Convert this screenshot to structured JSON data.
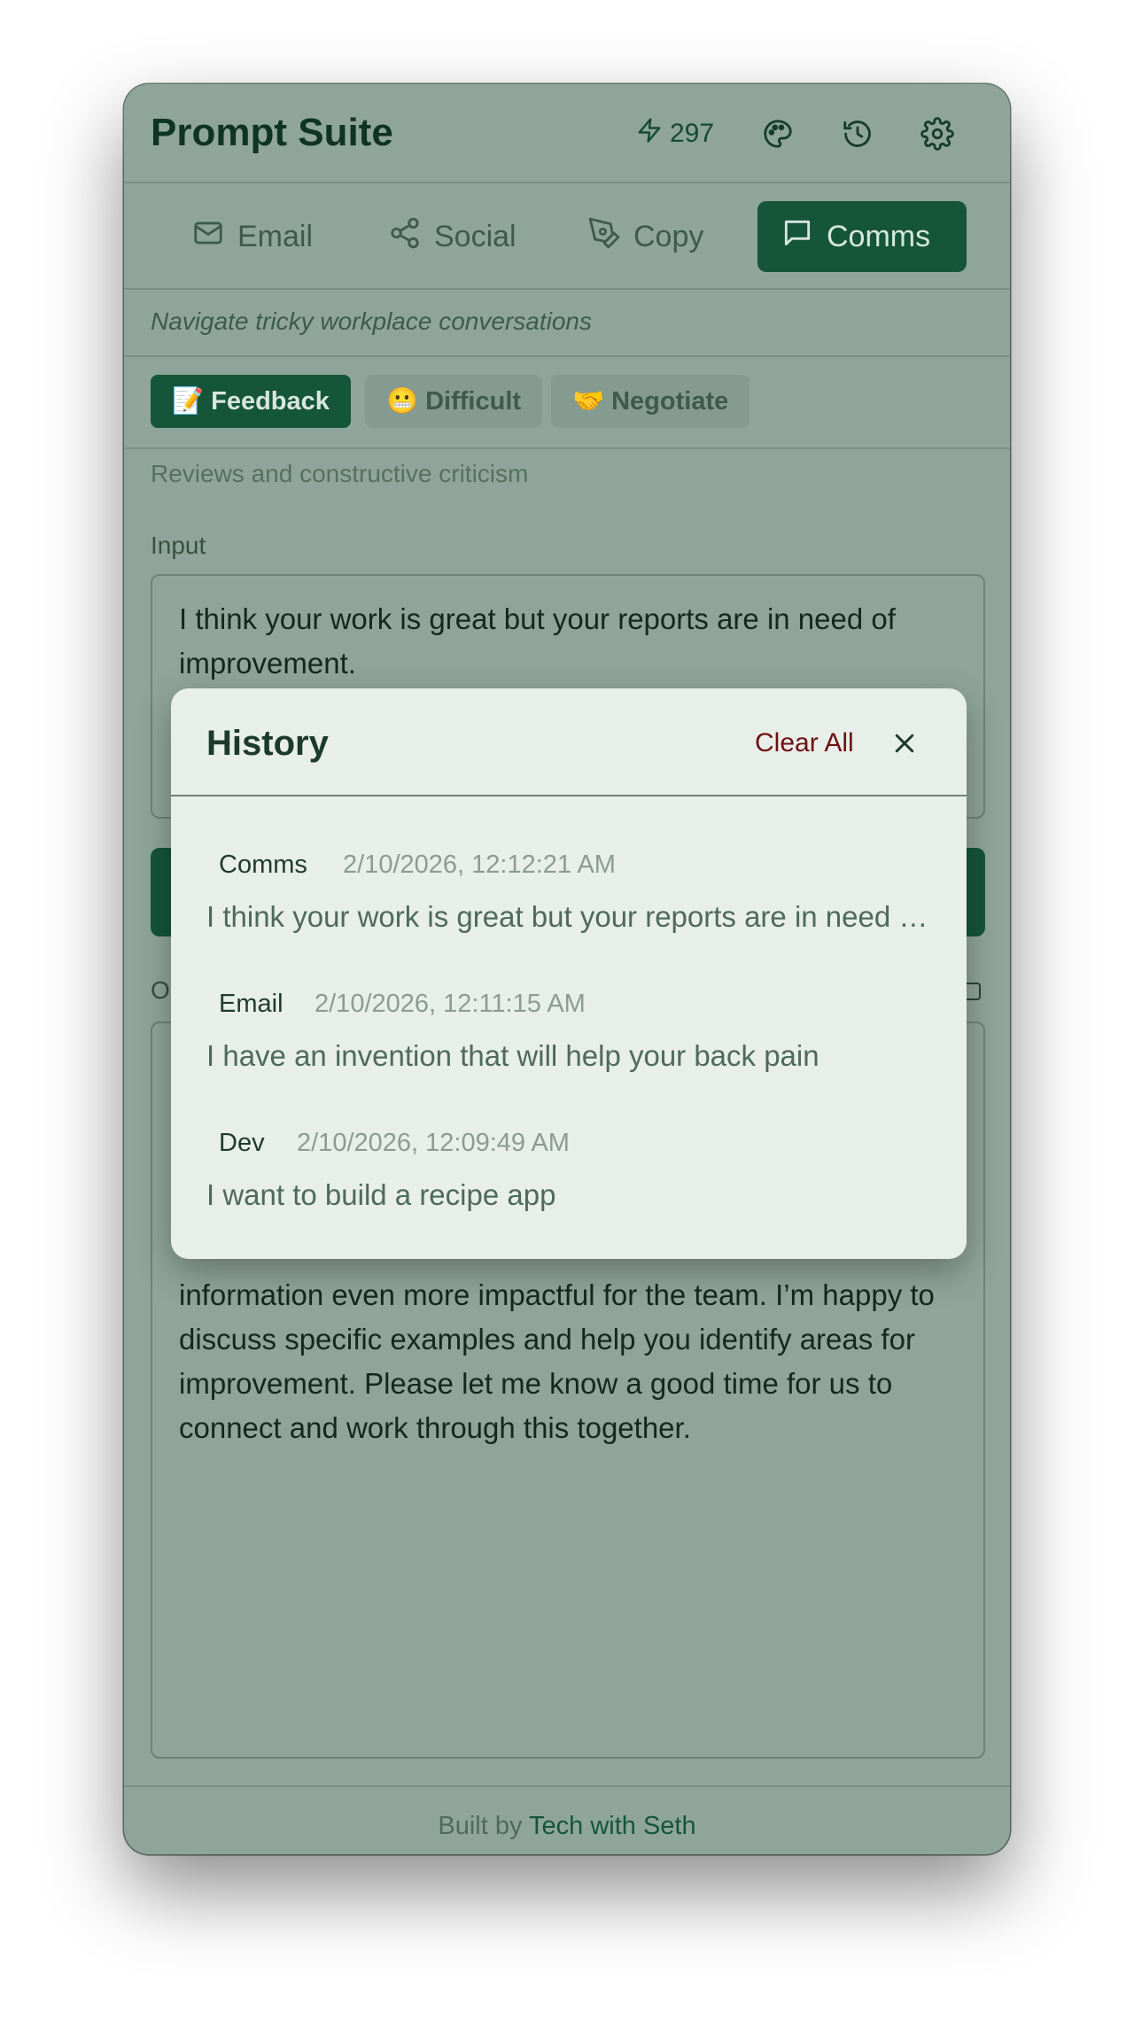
{
  "header": {
    "title": "Prompt Suite",
    "credits": "297"
  },
  "tabs": [
    {
      "label": "Email",
      "icon": "mail-icon"
    },
    {
      "label": "Social",
      "icon": "share-icon"
    },
    {
      "label": "Copy",
      "icon": "pen-icon"
    },
    {
      "label": "Comms",
      "icon": "chat-icon",
      "active": true
    }
  ],
  "tagline": "Navigate tricky workplace conversations",
  "subtabs": [
    {
      "emoji": "📝",
      "label": "Feedback",
      "active": true
    },
    {
      "emoji": "😬",
      "label": "Difficult"
    },
    {
      "emoji": "🤝",
      "label": "Negotiate"
    }
  ],
  "subtab_description": "Reviews and constructive criticism",
  "input": {
    "label": "Input",
    "value": "I think your work is great but your reports are in need of improvement."
  },
  "output": {
    "label": "O",
    "text": "information even more impactful for the team. I’m happy to discuss specific examples and help you identify areas for improvement. Please let me know a good time for us to connect and work through this together."
  },
  "footer": {
    "prefix": "Built by",
    "link": "Tech with Seth"
  },
  "history_modal": {
    "title": "History",
    "clear_all": "Clear All",
    "items": [
      {
        "category": "Comms",
        "timestamp": "2/10/2026, 12:12:21 AM",
        "text": "I think your work is great but your reports are in need of improvement."
      },
      {
        "category": "Email",
        "timestamp": "2/10/2026, 12:11:15 AM",
        "text": "I have an invention that will help your back pain"
      },
      {
        "category": "Dev",
        "timestamp": "2/10/2026, 12:09:49 AM",
        "text": "I want to build a recipe app"
      }
    ]
  },
  "colors": {
    "brand_green": "#15553a",
    "clear_all_red": "#6e1010",
    "overlay_tint": "#8fa59b"
  }
}
